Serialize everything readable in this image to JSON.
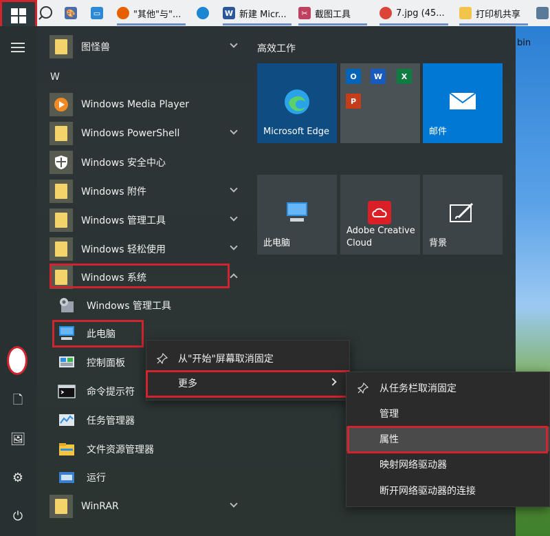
{
  "taskbar": {
    "items": [
      {
        "label": "",
        "icon": "paint-icon",
        "color": "#4a6ea8"
      },
      {
        "label": "",
        "icon": "monitor-icon",
        "color": "#2d89d6"
      },
      {
        "label": "\"其他\"与\"...",
        "icon": "firefox-icon",
        "color": "#e66000"
      },
      {
        "label": "",
        "icon": "edge-icon",
        "color": "#1b86d1"
      },
      {
        "label": "新建 Micr...",
        "icon": "word-icon",
        "color": "#2b579a"
      },
      {
        "label": "截图工具",
        "icon": "snipping-tool-icon",
        "color": "#c04060"
      },
      {
        "label": "7.jpg (45...",
        "icon": "chrome-icon",
        "color": "#db4437"
      },
      {
        "label": "打印机共享",
        "icon": "folder-icon",
        "color": "#f2c44b"
      }
    ]
  },
  "app_list": {
    "top_folder": "图怪兽",
    "letter": "W",
    "apps": [
      {
        "label": "Windows Media Player",
        "icon": "media-player-icon"
      },
      {
        "label": "Windows PowerShell",
        "icon": "folder-icon"
      },
      {
        "label": "Windows 安全中心",
        "icon": "shield-icon"
      },
      {
        "label": "Windows 附件",
        "icon": "folder-icon"
      },
      {
        "label": "Windows 管理工具",
        "icon": "folder-icon"
      },
      {
        "label": "Windows 轻松使用",
        "icon": "folder-icon"
      },
      {
        "label": "Windows 系统",
        "icon": "folder-icon"
      }
    ],
    "system_sub": [
      {
        "label": "Windows 管理工具",
        "icon": "admin-tools-icon"
      },
      {
        "label": "此电脑",
        "icon": "this-pc-icon"
      },
      {
        "label": "控制面板",
        "icon": "control-panel-icon"
      },
      {
        "label": "命令提示符",
        "icon": "cmd-icon"
      },
      {
        "label": "任务管理器",
        "icon": "task-manager-icon"
      },
      {
        "label": "文件资源管理器",
        "icon": "file-explorer-icon"
      },
      {
        "label": "运行",
        "icon": "run-icon"
      }
    ],
    "bottom_folder": "WinRAR"
  },
  "tiles": {
    "group_title": "高效工作",
    "edge_label": "Microsoft Edge",
    "mail_label": "邮件",
    "this_pc_label": "此电脑",
    "adobe_label": "Adobe Creative Cloud",
    "background_label": "背景"
  },
  "context_menu": {
    "unpin_start": "从\"开始\"屏幕取消固定",
    "more": "更多"
  },
  "submenu": {
    "items": [
      "从任务栏取消固定",
      "管理",
      "属性",
      "映射网络驱动器",
      "断开网络驱动器的连接"
    ]
  },
  "desktop": {
    "bin_label": "bin"
  },
  "colors": {
    "highlight": "#d1242f",
    "edge_blue": "#0f4c81",
    "mail_blue": "#0078d4",
    "tile_gray": "#3c4448"
  }
}
